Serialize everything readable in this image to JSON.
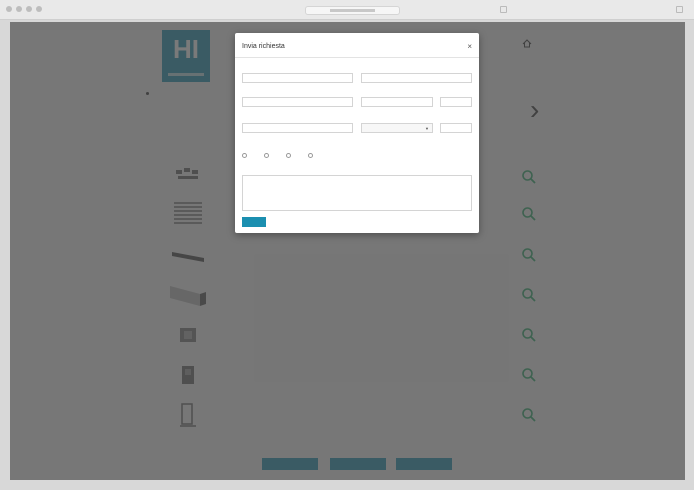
{
  "page": {
    "logo_text": "HI",
    "top_links": [
      "",
      "",
      ""
    ],
    "home_label": "",
    "left": {
      "heading": "",
      "items": [
        "",
        ""
      ],
      "search_label": ""
    },
    "table_headers": {
      "prodotti": "",
      "codice": "",
      "descrizione": "",
      "quantita": "",
      "aggiungi": ""
    },
    "products": [
      {
        "code": "",
        "name": "",
        "qty": ""
      },
      {
        "code": "",
        "name": "",
        "qty": ""
      },
      {
        "code": "",
        "name": "",
        "qty": ""
      },
      {
        "code": "",
        "name": "",
        "qty": ""
      },
      {
        "code": "",
        "name": "",
        "qty": ""
      },
      {
        "code": "",
        "name": "",
        "qty": ""
      },
      {
        "code": "",
        "name": "",
        "qty": ""
      }
    ],
    "bottom_buttons": [
      "",
      "",
      ""
    ],
    "bottom_note": ""
  },
  "modal": {
    "title": "Invia richiesta",
    "close_symbol": "×",
    "fields": {
      "nome": {
        "label": "",
        "value": ""
      },
      "cognome": {
        "label": "",
        "value": ""
      },
      "indirizzo": {
        "label": "",
        "value": ""
      },
      "citta": {
        "label": "",
        "value": ""
      },
      "provincia": {
        "label": "",
        "value": ""
      },
      "email": {
        "label": "",
        "value": ""
      },
      "nazione": {
        "label": "",
        "selected": ""
      },
      "cap": {
        "label": "",
        "value": ""
      }
    },
    "radio_group_label": "",
    "radio_options": [
      "",
      "",
      "",
      ""
    ],
    "note_label": "",
    "note_placeholder": "",
    "send_label": ""
  },
  "colors": {
    "accent": "#1b8fb0",
    "zoom_icon": "#2aa86a"
  }
}
